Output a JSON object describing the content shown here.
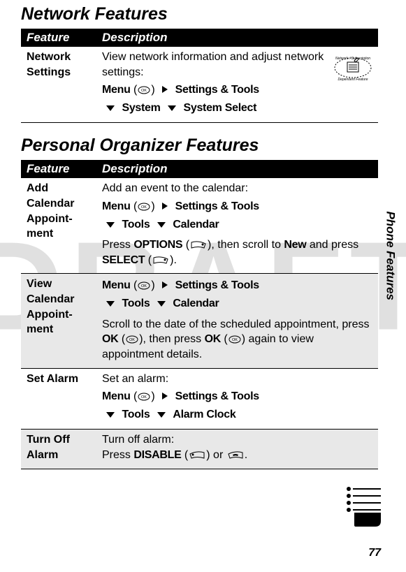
{
  "watermark": "DRAFT",
  "section1": {
    "title": "Network Features",
    "headers": {
      "feature": "Feature",
      "description": "Description"
    },
    "rows": [
      {
        "feature": "Network Settings",
        "intro": "View network information and adjust network settings:",
        "nav": {
          "menu": "Menu",
          "step1": "Settings & Tools",
          "step2": "System",
          "step3": "System Select"
        }
      }
    ]
  },
  "section2": {
    "title": "Personal Organizer Features",
    "headers": {
      "feature": "Feature",
      "description": "Description"
    },
    "rows": [
      {
        "feature": "Add Calendar Appoint-ment",
        "intro": "Add an event to the calendar:",
        "nav": {
          "menu": "Menu",
          "step1": "Settings & Tools",
          "step2": "Tools",
          "step3": "Calendar"
        },
        "after1_a": "Press ",
        "after1_options": "OPTIONS",
        "after1_b": " (",
        "after1_c": "), then scroll to ",
        "after1_new": "New",
        "after1_d": " and press ",
        "after1_select": "SELECT",
        "after1_e": " (",
        "after1_f": ")."
      },
      {
        "feature": "View Calendar Appoint-ment",
        "nav": {
          "menu": "Menu",
          "step1": "Settings & Tools",
          "step2": "Tools",
          "step3": "Calendar"
        },
        "after_a": "Scroll to the date of the scheduled appointment, press ",
        "after_ok": "OK",
        "after_b": " (",
        "after_c": "), then press ",
        "after_ok2": "OK",
        "after_d": " (",
        "after_e": ") again to view appointment details."
      },
      {
        "feature": "Set Alarm",
        "intro": "Set an alarm:",
        "nav": {
          "menu": "Menu",
          "step1": "Settings & Tools",
          "step2": "Tools",
          "step3": "Alarm Clock"
        }
      },
      {
        "feature": "Turn Off Alarm",
        "intro": "Turn off alarm:",
        "after_a": "Press ",
        "after_disable": "DISABLE",
        "after_b": " (",
        "after_c": ") or ",
        "after_d": "."
      }
    ]
  },
  "sideLabel": "Phone Features",
  "pageNumber": "77"
}
